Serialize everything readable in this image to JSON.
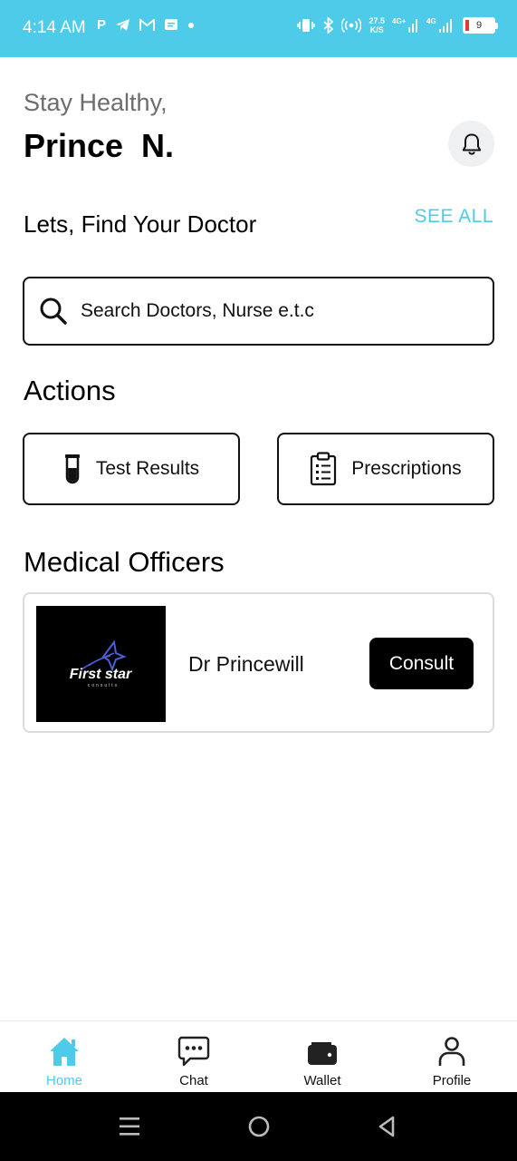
{
  "status_bar": {
    "time": "4:14 AM",
    "left_icons": [
      "p-app-icon",
      "telegram-icon",
      "gmail-icon",
      "message-icon",
      "dot-icon"
    ],
    "net_speed_value": "27.5",
    "net_speed_unit": "K/S",
    "battery_level": "9",
    "network_labels": [
      "4G+",
      "4G"
    ]
  },
  "header": {
    "greeting": "Stay Healthy,",
    "user_name": "Prince  N."
  },
  "find_section": {
    "title": "Lets, Find Your Doctor",
    "see_all_label": "SEE ALL"
  },
  "search": {
    "placeholder": "Search Doctors, Nurse e.t.c"
  },
  "actions": {
    "title": "Actions",
    "items": [
      {
        "label": "Test Results",
        "icon": "test-tube-icon"
      },
      {
        "label": "Prescriptions",
        "icon": "clipboard-list-icon"
      }
    ]
  },
  "medical_officers": {
    "title": "Medical Officers",
    "list": [
      {
        "name": "Dr Princewill",
        "logo_text": "First star",
        "logo_subtext": "consults",
        "action_label": "Consult"
      }
    ]
  },
  "bottom_nav": {
    "items": [
      {
        "label": "Home",
        "icon": "home-icon",
        "active": true
      },
      {
        "label": "Chat",
        "icon": "chat-icon",
        "active": false
      },
      {
        "label": "Wallet",
        "icon": "wallet-icon",
        "active": false
      },
      {
        "label": "Profile",
        "icon": "profile-icon",
        "active": false
      }
    ]
  },
  "colors": {
    "accent": "#4dcbe9",
    "primary_text": "#000000",
    "muted_text": "#6d6d6d",
    "button_dark": "#000000"
  }
}
